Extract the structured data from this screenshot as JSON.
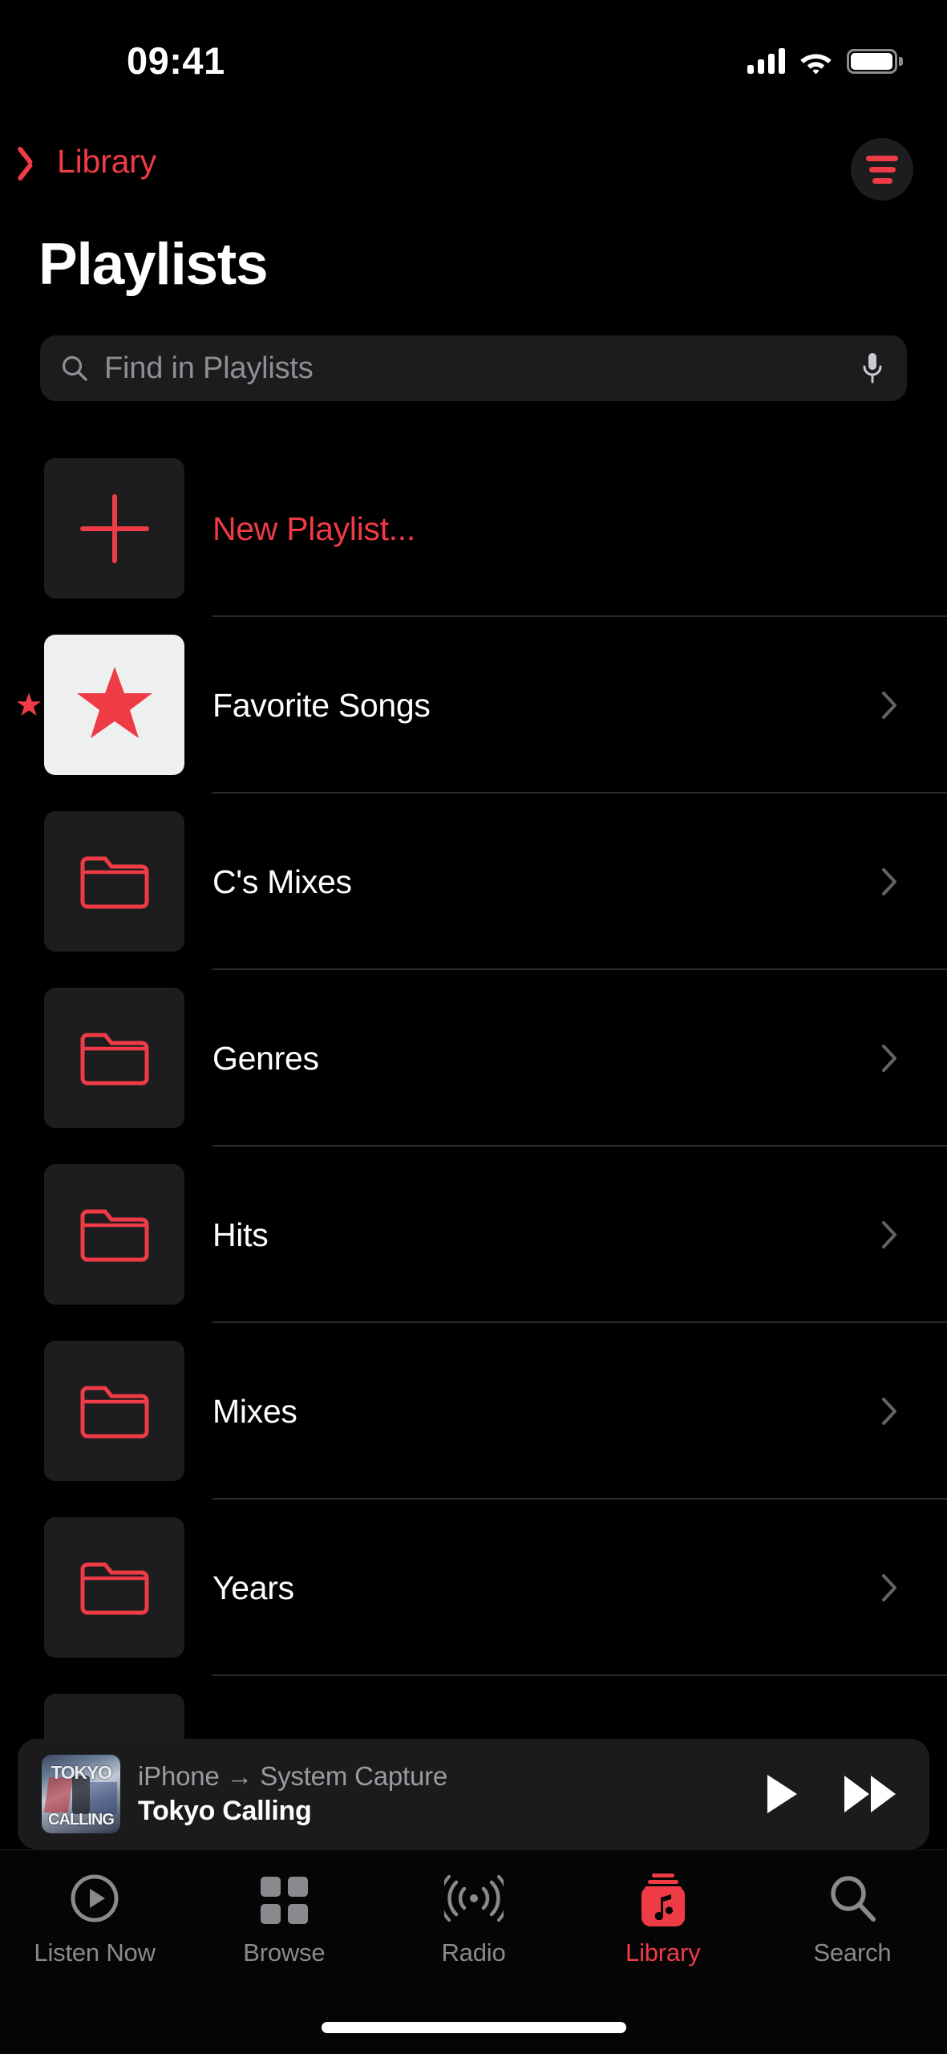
{
  "status_bar": {
    "time": "09:41",
    "cellular_icon": "cellular-signal-icon",
    "cellular_bars": 4,
    "wifi_icon": "wifi-icon",
    "battery_icon": "battery-icon",
    "battery_level": 90
  },
  "nav": {
    "back_label": "Library",
    "back_icon": "chevron-left-icon",
    "filter_icon": "filter-sort-icon"
  },
  "page_title": "Playlists",
  "search": {
    "placeholder": "Find in Playlists",
    "value": "",
    "search_icon": "search-icon",
    "mic_icon": "microphone-icon"
  },
  "list": {
    "rows": [
      {
        "label": "New Playlist...",
        "icon": "plus-icon",
        "accent": true,
        "thumb_style": "dark",
        "chevron": false,
        "index_marker": ""
      },
      {
        "label": "Favorite Songs",
        "icon": "star-icon",
        "accent": false,
        "thumb_style": "light",
        "chevron": true,
        "index_marker": "star-index-icon"
      },
      {
        "label": "C's Mixes",
        "icon": "folder-icon",
        "accent": false,
        "thumb_style": "dark",
        "chevron": true,
        "index_marker": ""
      },
      {
        "label": "Genres",
        "icon": "folder-icon",
        "accent": false,
        "thumb_style": "dark",
        "chevron": true,
        "index_marker": ""
      },
      {
        "label": "Hits",
        "icon": "folder-icon",
        "accent": false,
        "thumb_style": "dark",
        "chevron": true,
        "index_marker": ""
      },
      {
        "label": "Mixes",
        "icon": "folder-icon",
        "accent": false,
        "thumb_style": "dark",
        "chevron": true,
        "index_marker": ""
      },
      {
        "label": "Years",
        "icon": "folder-icon",
        "accent": false,
        "thumb_style": "dark",
        "chevron": true,
        "index_marker": ""
      },
      {
        "label": "",
        "icon": "folder-icon",
        "accent": false,
        "thumb_style": "dark",
        "chevron": false,
        "index_marker": ""
      }
    ]
  },
  "mini_player": {
    "route": "iPhone → System Capture",
    "track": "Tokyo Calling",
    "artwork_top_text": "TOKYO",
    "artwork_bottom_text": "CALLING",
    "play_icon": "play-icon",
    "forward_icon": "fast-forward-icon"
  },
  "tab_bar": {
    "items": [
      {
        "label": "Listen Now",
        "icon": "play-circle-icon",
        "active": false
      },
      {
        "label": "Browse",
        "icon": "grid-squares-icon",
        "active": false
      },
      {
        "label": "Radio",
        "icon": "radio-waves-icon",
        "active": false
      },
      {
        "label": "Library",
        "icon": "music-library-icon",
        "active": true
      },
      {
        "label": "Search",
        "icon": "search-icon",
        "active": false
      }
    ]
  },
  "colors": {
    "accent": "#ef3b45",
    "background": "#000000",
    "surface": "#1d1d1f",
    "secondary_text": "#8e8e93",
    "separator": "#2b2b2d"
  }
}
